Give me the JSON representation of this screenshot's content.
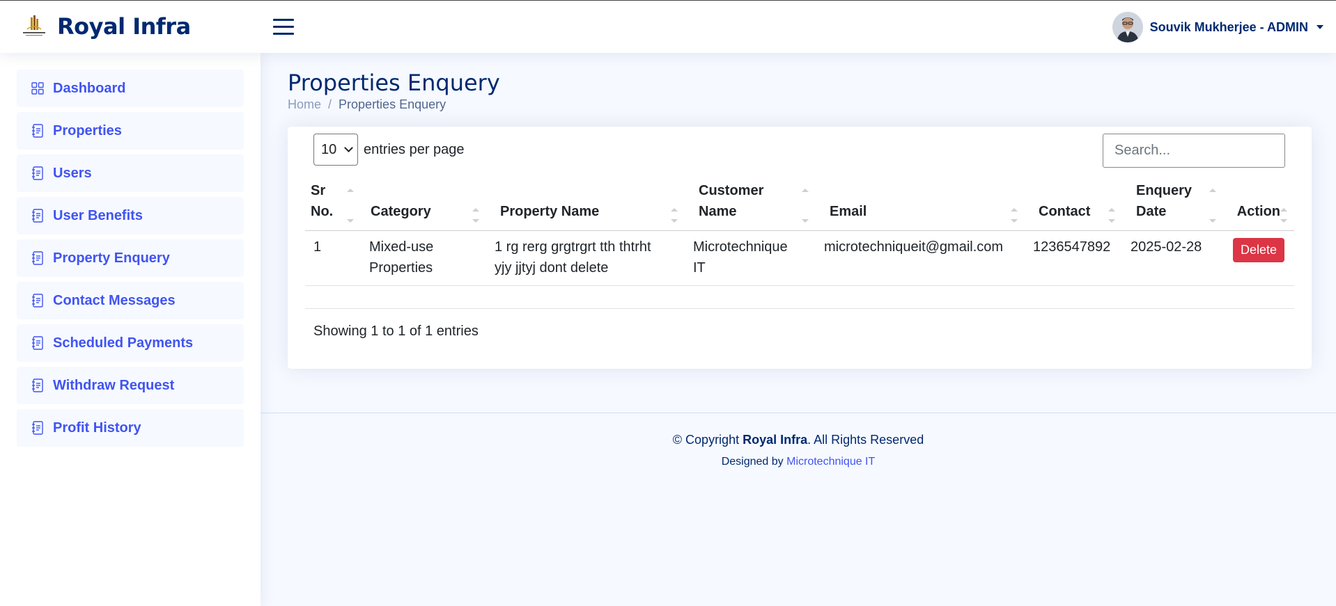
{
  "header": {
    "brand": "Royal Infra",
    "user_name": "Souvik Mukherjee - ADMIN"
  },
  "sidebar": {
    "items": [
      {
        "label": "Dashboard",
        "icon": "grid-icon"
      },
      {
        "label": "Properties",
        "icon": "journal-text-icon"
      },
      {
        "label": "Users",
        "icon": "journal-text-icon"
      },
      {
        "label": "User Benefits",
        "icon": "journal-text-icon"
      },
      {
        "label": "Property Enquery",
        "icon": "journal-text-icon"
      },
      {
        "label": "Contact Messages",
        "icon": "journal-text-icon"
      },
      {
        "label": "Scheduled Payments",
        "icon": "journal-text-icon"
      },
      {
        "label": "Withdraw Request",
        "icon": "journal-text-icon"
      },
      {
        "label": "Profit History",
        "icon": "journal-text-icon"
      }
    ]
  },
  "page": {
    "title": "Properties Enquery",
    "breadcrumb": {
      "home": "Home",
      "separator": "/",
      "current": "Properties Enquery"
    }
  },
  "table": {
    "per_page_value": "10",
    "per_page_label": "entries per page",
    "search_placeholder": "Search...",
    "columns": {
      "sr_line1": "Sr",
      "sr_line2": "No.",
      "category": "Category",
      "property_name": "Property Name",
      "customer_line1": "Customer",
      "customer_line2": "Name",
      "email": "Email",
      "contact": "Contact",
      "date_line1": "Enquery",
      "date_line2": "Date",
      "action": "Action"
    },
    "rows": [
      {
        "sr": "1",
        "category_line1": "Mixed-use",
        "category_line2": "Properties",
        "property_line1": "1 rg rerg grgtrgrt tth thtrht",
        "property_line2": "yjy jjtyj dont delete",
        "customer_line1": "Microtechnique",
        "customer_line2": "IT",
        "email": "microtechniqueit@gmail.com",
        "contact": "1236547892",
        "date": "2025-02-28",
        "action_label": "Delete"
      }
    ],
    "summary": "Showing 1 to 1 of 1 entries"
  },
  "footer": {
    "copyright_prefix": "© Copyright",
    "copyright_brand": "Royal Infra",
    "copyright_suffix": ". All Rights Reserved",
    "designed_by": "Designed by",
    "designer": "Microtechnique IT"
  },
  "colors": {
    "brand_navy": "#012970",
    "accent_blue": "#4154f1",
    "danger": "#dc3545",
    "page_bg": "#f6f9ff"
  }
}
